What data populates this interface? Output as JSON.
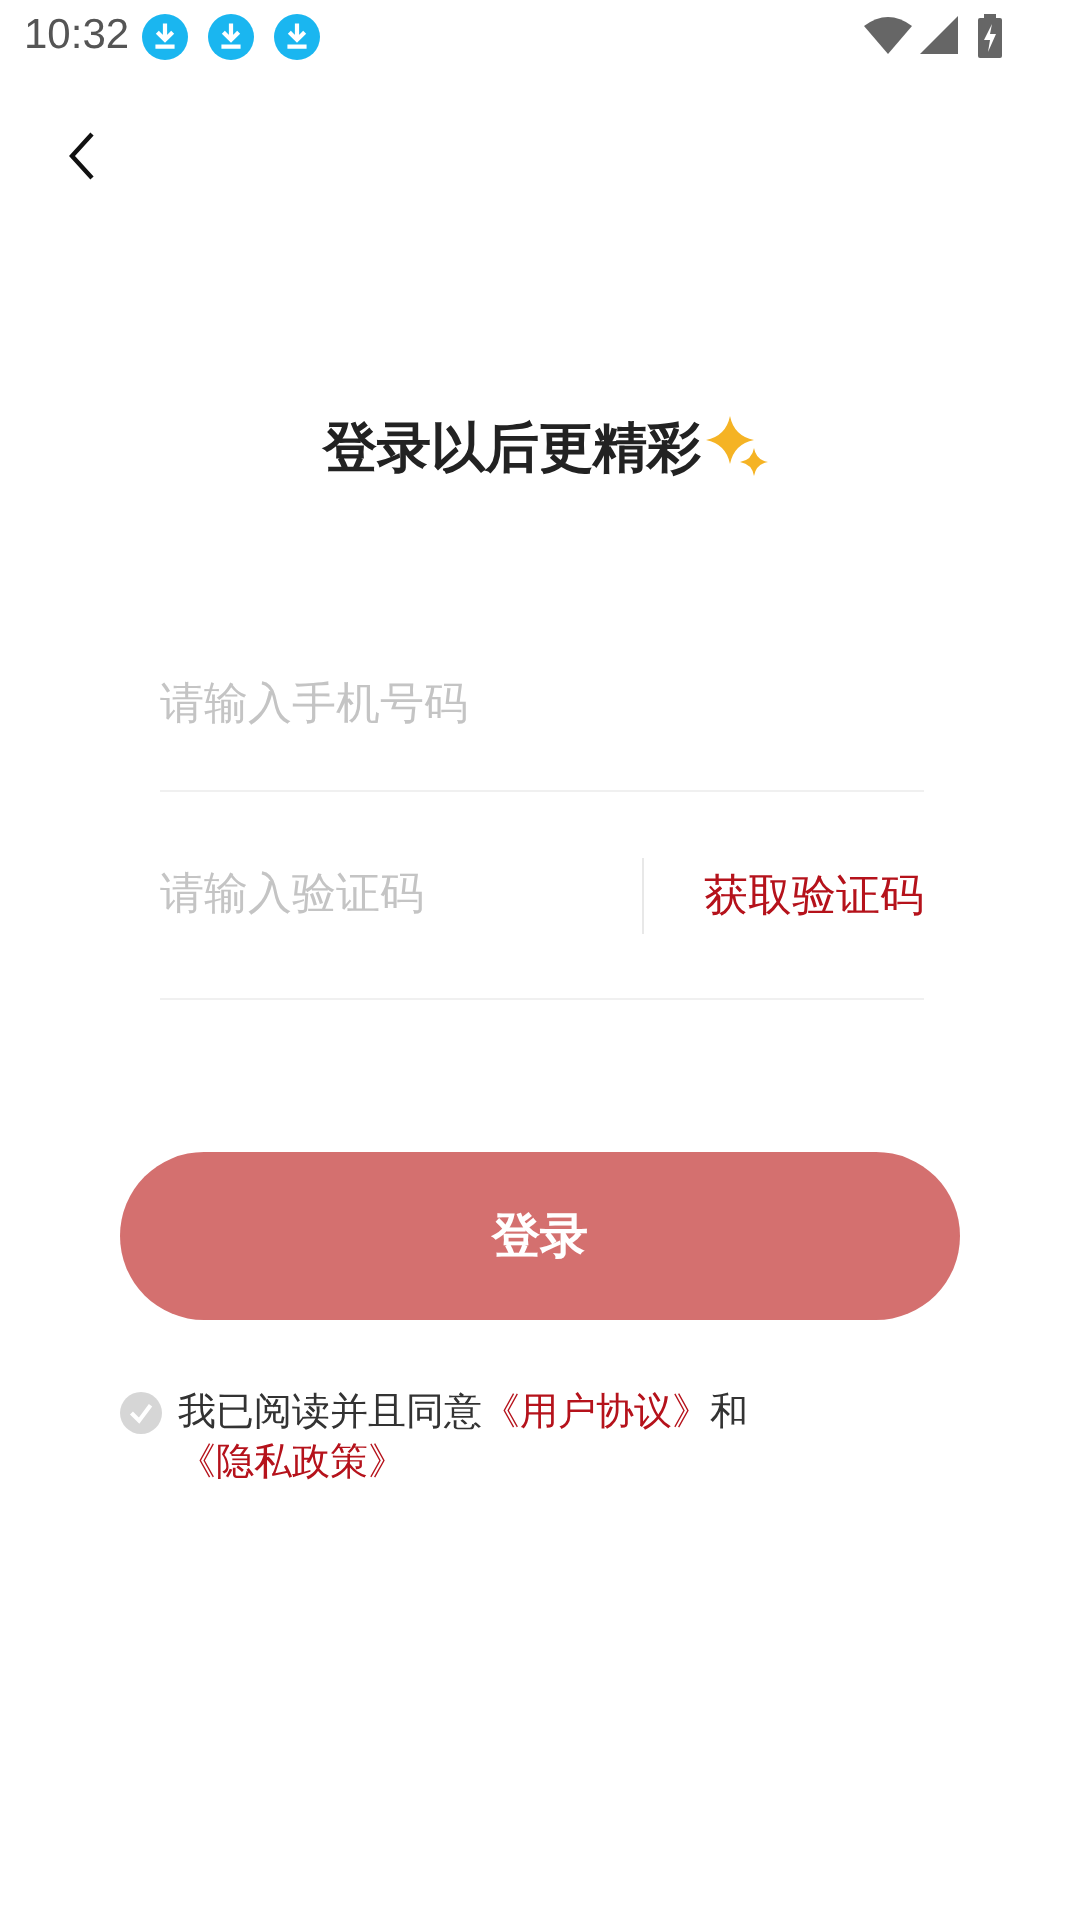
{
  "status_bar": {
    "time": "10:32",
    "notifications": [
      {
        "kind": "download"
      },
      {
        "kind": "download"
      },
      {
        "kind": "download"
      }
    ]
  },
  "title": "登录以后更精彩",
  "phone_field": {
    "placeholder": "请输入手机号码"
  },
  "code_field": {
    "placeholder": "请输入验证码"
  },
  "get_code_button": {
    "label": "获取验证码"
  },
  "login_button": {
    "label": "登录",
    "disabled": true
  },
  "agreement": {
    "checked": false,
    "parts": [
      {
        "kind": "plain",
        "text": "我已阅读并且同意"
      },
      {
        "kind": "link",
        "text": "《用户协议》"
      },
      {
        "kind": "plain",
        "text": "和"
      },
      {
        "kind": "link",
        "text": "《隐私政策》"
      }
    ]
  }
}
